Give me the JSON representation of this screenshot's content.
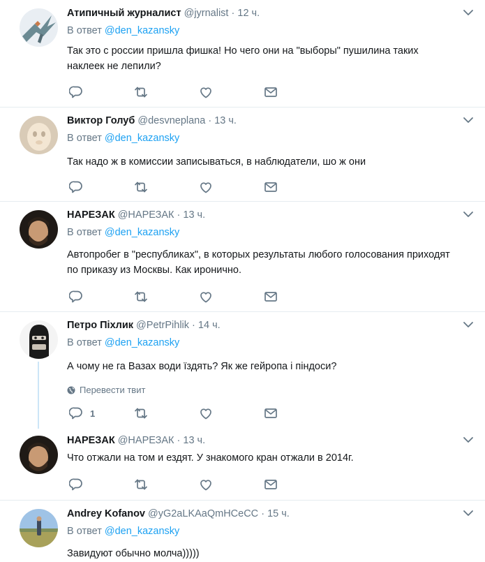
{
  "tweets": [
    {
      "name": "Атипичный журналист",
      "handle": "@jyrnalist",
      "time": "12 ч.",
      "reply_prefix": "В ответ",
      "reply_to": "@den_kazansky",
      "text": "Так это с россии пришла фишка! Но чего они на \"выборы\" пушилина таких наклеек не лепили?"
    },
    {
      "name": "Виктор Голуб",
      "handle": "@desvneplana",
      "time": "13 ч.",
      "reply_prefix": "В ответ",
      "reply_to": "@den_kazansky",
      "text": "Так надо ж в комиссии записываться, в наблюдатели, шо ж они"
    },
    {
      "name": "НАРЕЗАК",
      "handle": "@НАРЕЗАК",
      "time": "13 ч.",
      "reply_prefix": "В ответ",
      "reply_to": "@den_kazansky",
      "text": "Автопробег в \"республиках\", в которых результаты любого голосования приходят по приказу из Москвы. Как иронично."
    },
    {
      "name": "Петро Піхлик",
      "handle": "@PetrPihlik",
      "time": "14 ч.",
      "reply_prefix": "В ответ",
      "reply_to": "@den_kazansky",
      "text": "А чому не га Вазах води їздять? Як же гейропа і піндоси?",
      "translate": "Перевести твит",
      "reply_count": "1"
    },
    {
      "name": "НАРЕЗАК",
      "handle": "@НАРЕЗАК",
      "time": "13 ч.",
      "text": "Что отжали на том и ездят. У знакомого кран отжали в 2014г."
    },
    {
      "name": "Andrey Kofanov",
      "handle": "@yG2aLKAaQmHCeCC",
      "time": "15 ч.",
      "reply_prefix": "В ответ",
      "reply_to": "@den_kazansky",
      "text": "Завидуют обычно молча)))))"
    }
  ],
  "dot": "·",
  "icons": [
    "reply-icon",
    "retweet-icon",
    "like-icon",
    "message-icon",
    "chevron-down-icon",
    "globe-icon"
  ],
  "colors": {
    "link": "#1da1f2",
    "muted": "#657786",
    "border": "#e6ecf0",
    "thread": "#cce5f7"
  }
}
